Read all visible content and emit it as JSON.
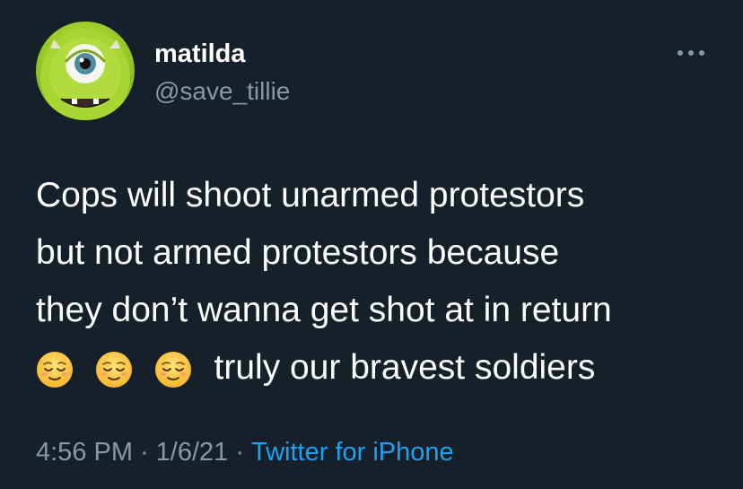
{
  "user": {
    "display_name": "matilda",
    "handle": "@save_tillie",
    "avatar_icon": "mike-wazowski-avatar"
  },
  "tweet": {
    "lines": [
      "Cops will shoot unarmed protestors",
      "but not armed protestors because",
      "they don’t wanna get shot at in return"
    ],
    "emoji": [
      "relieved-face-emoji",
      "relieved-face-emoji",
      "relieved-face-emoji"
    ],
    "last_line_text": "truly our bravest soldiers"
  },
  "meta": {
    "time": "4:56 PM",
    "separator": "·",
    "date": "1/6/21",
    "source": "Twitter for iPhone"
  },
  "colors": {
    "background": "#15202b",
    "text": "#ffffff",
    "secondary": "#8899a6",
    "link": "#1da1f2"
  },
  "icons": {
    "more": "more-options-icon"
  }
}
